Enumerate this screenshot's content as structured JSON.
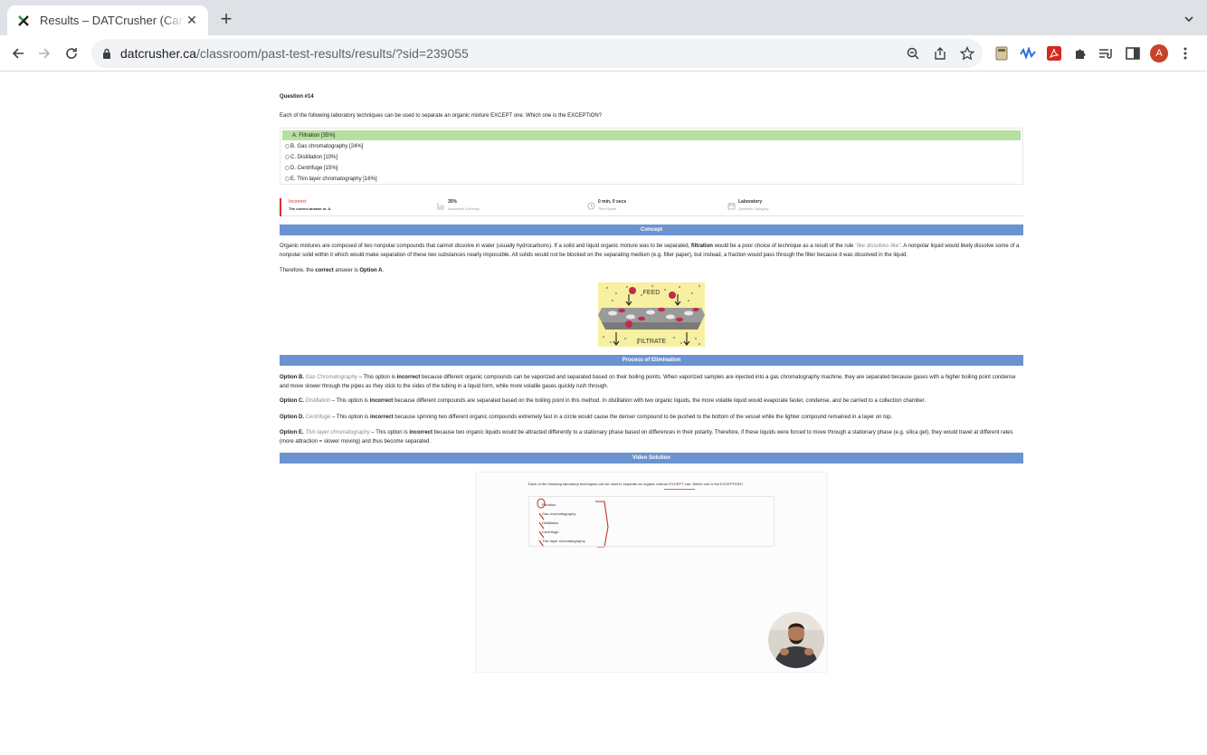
{
  "browser": {
    "tab_title": "Results – DATCrusher (Canadian DAT)",
    "url_host": "datcrusher.ca",
    "url_path": "/classroom/past-test-results/results/?sid=239055",
    "avatar_letter": "A"
  },
  "question": {
    "number_label": "Question #14",
    "text": "Each of the following laboratory techniques can be used to separate an organic mixture EXCEPT one. Which one is the EXCEPTION?",
    "answers": [
      {
        "label": "A. Filtration [35%]",
        "correct": true
      },
      {
        "label": "B. Gas chromatography [24%]",
        "correct": false
      },
      {
        "label": "C. Distillation [10%]",
        "correct": false
      },
      {
        "label": "D. Centrifuge [15%]",
        "correct": false
      },
      {
        "label": "E. Thin layer chromatography [16%]",
        "correct": false
      }
    ]
  },
  "stats": {
    "result": "Incorrect",
    "result_sub": "The correct answer is: A.",
    "percent": "35%",
    "percent_sub": "Answered Correctly",
    "time": "0 min, 0 secs",
    "time_sub": "Time Spent",
    "category": "Laboratory",
    "category_sub": "Question Category"
  },
  "concept": {
    "heading": "Concept",
    "p1_a": "Organic mixtures are composed of two nonpolar compounds that cannot dissolve in water (usually hydrocarbons). If a solid and liquid organic mixture was to be separated, ",
    "p1_b": "filtration",
    "p1_c": " would be a poor choice of technique as a result of the rule ",
    "p1_d": "\"like dissolves like\"",
    "p1_e": ". A nonpolar liquid would likely dissolve some of a nonpolar solid within it which would make separation of these two substances nearly impossible. All solids would not be blocked on the separating medium (e.g. filter paper), but instead, a fraction would pass through the filter because it was dissolved in the liquid.",
    "p2_a": "Therefore, the ",
    "p2_b": "correct",
    "p2_c": " answer is ",
    "p2_d": "Option A",
    "p2_e": ".",
    "figure_top": "FEED",
    "figure_bottom": "FILTRATE"
  },
  "elimination": {
    "heading": "Process of Elimination",
    "items": [
      {
        "opt": "Option B.",
        "name": "Gas Chromatography",
        "a": " – This option is ",
        "b": "incorrect",
        "c": " because different organic compounds can be vaporized and separated based on their boiling points. When vaporized samples are injected into a gas chromatography machine, they are separated because gases with a higher boiling point condense and move slower through the pipes as they stick to the sides of the tubing in a liquid form, while more volatile gases quickly rush through."
      },
      {
        "opt": "Option C.",
        "name": "Distillation",
        "a": " – This option is ",
        "b": "incorrect",
        "c": " because different compounds are separated based on the boiling point in this method. In distillation with two organic liquids, the more volatile liquid would evaporate faster, condense, and be carried to a collection chamber."
      },
      {
        "opt": "Option D.",
        "name": "Centrifuge",
        "a": " – This option is ",
        "b": "incorrect",
        "c": " because spinning two different organic compounds extremely fast in a circle would cause the denser compound to be pushed to the bottom of the vessel while the lighter compound remained in a layer on top."
      },
      {
        "opt": "Option E.",
        "name": "Thin layer chromatography",
        "a": " – This option is ",
        "b": "incorrect",
        "c": " because two organic liquids would be attracted differently to a stationary phase based on differences in their polarity. Therefore, if these liquids were forced to move through a stationary phase (e.g. silica gel), they would travel at different rates (more attraction = slower moving) and thus become separated."
      }
    ]
  },
  "video": {
    "heading": "Video Solution",
    "q_text": "Each of the following laboratory techniques can be used to separate an organic mixture EXCEPT one. Which one is the EXCEPTION?",
    "options": [
      "Filtration",
      "Gas chromatography",
      "Distillation",
      "Centrifuge",
      "Thin layer chromatography"
    ]
  },
  "colors": {
    "band_blue": "#6a93d0",
    "correct_green": "#b7dfa0",
    "incorrect_red": "#d9322b"
  }
}
